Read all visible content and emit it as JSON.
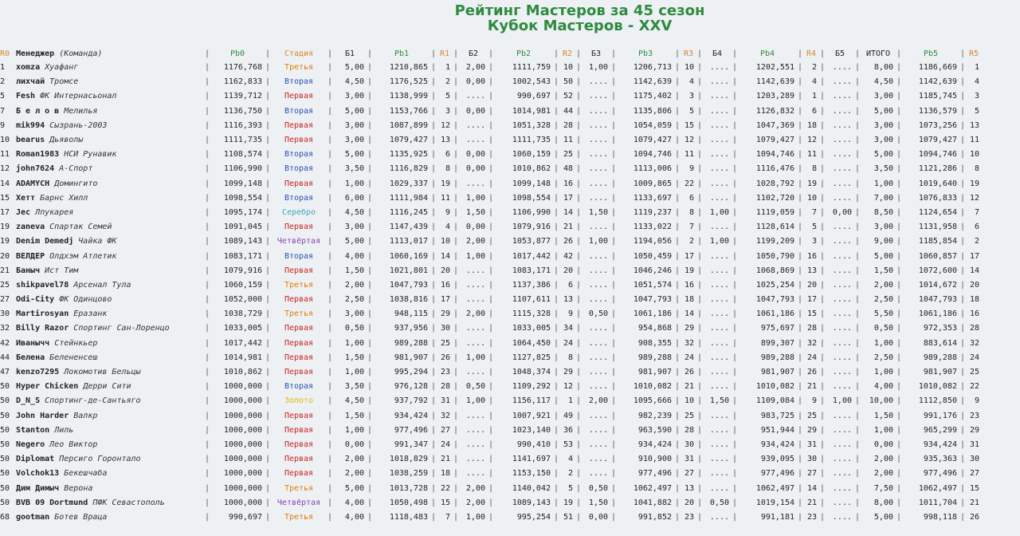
{
  "title": {
    "line1": "Рейтинг Мастеров за 45 сезон",
    "line2": "Кубок Мастеров - XXV"
  },
  "colors": {
    "title": "#2e8b3e",
    "background": "#edf1f4",
    "Третья": "#e07b00",
    "Вторая": "#2a4fb5",
    "Первая": "#d02020",
    "Серебро": "#3aa9b5",
    "Четвёртая": "#8a3fb5",
    "Золото": "#f0b400"
  },
  "header": {
    "r0": "R0",
    "manager": "Менеджер",
    "team": "(Команда)",
    "rb0": "Рb0",
    "stage": "Стадия",
    "b1": "Б1",
    "rb1": "Рb1",
    "r1": "R1",
    "b2": "Б2",
    "rb2": "Рb2",
    "r2": "R2",
    "b3": "Б3",
    "rb3": "Рb3",
    "r3": "R3",
    "b4": "Б4",
    "rb4": "Рb4",
    "r4": "R4",
    "b5": "Б5",
    "total": "ИТОГО",
    "rb5": "Рb5",
    "r5": "R5"
  },
  "rows": [
    {
      "r0": "1",
      "manager": "xomza",
      "team": "Хуафанг",
      "rb0": "1176,768",
      "stage": "Третья",
      "b1": "5,00",
      "rb1": "1210,865",
      "r1": "1",
      "b2": "2,00",
      "rb2": "1111,759",
      "r2": "10",
      "b3": "1,00",
      "rb3": "1206,713",
      "r3": "10",
      "b4": "....",
      "rb4": "1202,551",
      "r4": "2",
      "b5": "....",
      "total": "8,00",
      "rb5": "1186,669",
      "r5": "1"
    },
    {
      "r0": "2",
      "manager": "лихчай",
      "team": "Тромсе",
      "rb0": "1162,833",
      "stage": "Вторая",
      "b1": "4,50",
      "rb1": "1176,525",
      "r1": "2",
      "b2": "0,00",
      "rb2": "1002,543",
      "r2": "50",
      "b3": "....",
      "rb3": "1142,639",
      "r3": "4",
      "b4": "....",
      "rb4": "1142,639",
      "r4": "4",
      "b5": "....",
      "total": "4,50",
      "rb5": "1142,639",
      "r5": "4"
    },
    {
      "r0": "5",
      "manager": "Fesh",
      "team": "ФК Интернасьонал",
      "rb0": "1139,712",
      "stage": "Первая",
      "b1": "3,00",
      "rb1": "1138,999",
      "r1": "5",
      "b2": "....",
      "rb2": "990,697",
      "r2": "52",
      "b3": "....",
      "rb3": "1175,402",
      "r3": "3",
      "b4": "....",
      "rb4": "1203,289",
      "r4": "1",
      "b5": "....",
      "total": "3,00",
      "rb5": "1185,745",
      "r5": "3"
    },
    {
      "r0": "7",
      "manager": "Б е л о в",
      "team": "Мелилья",
      "rb0": "1136,750",
      "stage": "Вторая",
      "b1": "5,00",
      "rb1": "1153,766",
      "r1": "3",
      "b2": "0,00",
      "rb2": "1014,981",
      "r2": "44",
      "b3": "....",
      "rb3": "1135,806",
      "r3": "5",
      "b4": "....",
      "rb4": "1126,832",
      "r4": "6",
      "b5": "....",
      "total": "5,00",
      "rb5": "1136,579",
      "r5": "5"
    },
    {
      "r0": "9",
      "manager": "mik994",
      "team": "Сызрань-2003",
      "rb0": "1116,393",
      "stage": "Первая",
      "b1": "3,00",
      "rb1": "1087,899",
      "r1": "12",
      "b2": "....",
      "rb2": "1051,328",
      "r2": "28",
      "b3": "....",
      "rb3": "1054,059",
      "r3": "15",
      "b4": "....",
      "rb4": "1047,369",
      "r4": "18",
      "b5": "....",
      "total": "3,00",
      "rb5": "1073,256",
      "r5": "13"
    },
    {
      "r0": "10",
      "manager": "bearus",
      "team": "Дьяволы",
      "rb0": "1111,735",
      "stage": "Первая",
      "b1": "3,00",
      "rb1": "1079,427",
      "r1": "13",
      "b2": "....",
      "rb2": "1111,735",
      "r2": "11",
      "b3": "....",
      "rb3": "1079,427",
      "r3": "12",
      "b4": "....",
      "rb4": "1079,427",
      "r4": "12",
      "b5": "....",
      "total": "3,00",
      "rb5": "1079,427",
      "r5": "11"
    },
    {
      "r0": "11",
      "manager": "Roman1983",
      "team": "НСИ Рунавик",
      "rb0": "1108,574",
      "stage": "Вторая",
      "b1": "5,00",
      "rb1": "1135,925",
      "r1": "6",
      "b2": "0,00",
      "rb2": "1060,159",
      "r2": "25",
      "b3": "....",
      "rb3": "1094,746",
      "r3": "11",
      "b4": "....",
      "rb4": "1094,746",
      "r4": "11",
      "b5": "....",
      "total": "5,00",
      "rb5": "1094,746",
      "r5": "10"
    },
    {
      "r0": "12",
      "manager": "john7624",
      "team": "А-Спорт",
      "rb0": "1106,990",
      "stage": "Вторая",
      "b1": "3,50",
      "rb1": "1116,829",
      "r1": "8",
      "b2": "0,00",
      "rb2": "1010,862",
      "r2": "48",
      "b3": "....",
      "rb3": "1113,006",
      "r3": "9",
      "b4": "....",
      "rb4": "1116,476",
      "r4": "8",
      "b5": "....",
      "total": "3,50",
      "rb5": "1121,286",
      "r5": "8"
    },
    {
      "r0": "14",
      "manager": "ADAMYCH",
      "team": "Домингито",
      "rb0": "1099,148",
      "stage": "Первая",
      "b1": "1,00",
      "rb1": "1029,337",
      "r1": "19",
      "b2": "....",
      "rb2": "1099,148",
      "r2": "16",
      "b3": "....",
      "rb3": "1009,865",
      "r3": "22",
      "b4": "....",
      "rb4": "1028,792",
      "r4": "19",
      "b5": "....",
      "total": "1,00",
      "rb5": "1019,640",
      "r5": "19"
    },
    {
      "r0": "15",
      "manager": "Хетт",
      "team": "Барнс Хилл",
      "rb0": "1098,554",
      "stage": "Вторая",
      "b1": "6,00",
      "rb1": "1111,984",
      "r1": "11",
      "b2": "1,00",
      "rb2": "1098,554",
      "r2": "17",
      "b3": "....",
      "rb3": "1133,697",
      "r3": "6",
      "b4": "....",
      "rb4": "1102,720",
      "r4": "10",
      "b5": "....",
      "total": "7,00",
      "rb5": "1076,833",
      "r5": "12"
    },
    {
      "r0": "17",
      "manager": "Jec",
      "team": "Лпукарея",
      "rb0": "1095,174",
      "stage": "Серебро",
      "b1": "4,50",
      "rb1": "1116,245",
      "r1": "9",
      "b2": "1,50",
      "rb2": "1106,990",
      "r2": "14",
      "b3": "1,50",
      "rb3": "1119,237",
      "r3": "8",
      "b4": "1,00",
      "rb4": "1119,059",
      "r4": "7",
      "b5": "0,00",
      "total": "8,50",
      "rb5": "1124,654",
      "r5": "7"
    },
    {
      "r0": "19",
      "manager": "zaneva",
      "team": "Спартак Семей",
      "rb0": "1091,045",
      "stage": "Первая",
      "b1": "3,00",
      "rb1": "1147,439",
      "r1": "4",
      "b2": "0,00",
      "rb2": "1079,916",
      "r2": "21",
      "b3": "....",
      "rb3": "1133,022",
      "r3": "7",
      "b4": "....",
      "rb4": "1128,614",
      "r4": "5",
      "b5": "....",
      "total": "3,00",
      "rb5": "1131,958",
      "r5": "6"
    },
    {
      "r0": "19",
      "manager": "Denim Demedj",
      "team": "Чайка ФК",
      "rb0": "1089,143",
      "stage": "Четвёртая",
      "b1": "5,00",
      "rb1": "1113,017",
      "r1": "10",
      "b2": "2,00",
      "rb2": "1053,877",
      "r2": "26",
      "b3": "1,00",
      "rb3": "1194,056",
      "r3": "2",
      "b4": "1,00",
      "rb4": "1199,209",
      "r4": "3",
      "b5": "....",
      "total": "9,00",
      "rb5": "1185,854",
      "r5": "2"
    },
    {
      "r0": "20",
      "manager": "ВЕЛДЕР",
      "team": "Олдхэм Атлетик",
      "rb0": "1083,171",
      "stage": "Вторая",
      "b1": "4,00",
      "rb1": "1060,169",
      "r1": "14",
      "b2": "1,00",
      "rb2": "1017,442",
      "r2": "42",
      "b3": "....",
      "rb3": "1050,459",
      "r3": "17",
      "b4": "....",
      "rb4": "1050,790",
      "r4": "16",
      "b5": "....",
      "total": "5,00",
      "rb5": "1060,857",
      "r5": "17"
    },
    {
      "r0": "21",
      "manager": "Баныч",
      "team": "Ист Тим",
      "rb0": "1079,916",
      "stage": "Первая",
      "b1": "1,50",
      "rb1": "1021,801",
      "r1": "20",
      "b2": "....",
      "rb2": "1083,171",
      "r2": "20",
      "b3": "....",
      "rb3": "1046,246",
      "r3": "19",
      "b4": "....",
      "rb4": "1068,869",
      "r4": "13",
      "b5": "....",
      "total": "1,50",
      "rb5": "1072,600",
      "r5": "14"
    },
    {
      "r0": "25",
      "manager": "shikpavel78",
      "team": "Арсенал Тула",
      "rb0": "1060,159",
      "stage": "Третья",
      "b1": "2,00",
      "rb1": "1047,793",
      "r1": "16",
      "b2": "....",
      "rb2": "1137,386",
      "r2": "6",
      "b3": "....",
      "rb3": "1051,574",
      "r3": "16",
      "b4": "....",
      "rb4": "1025,254",
      "r4": "20",
      "b5": "....",
      "total": "2,00",
      "rb5": "1014,672",
      "r5": "20"
    },
    {
      "r0": "27",
      "manager": "Odi-City",
      "team": "ФК Одинцово",
      "rb0": "1052,000",
      "stage": "Первая",
      "b1": "2,50",
      "rb1": "1038,816",
      "r1": "17",
      "b2": "....",
      "rb2": "1107,611",
      "r2": "13",
      "b3": "....",
      "rb3": "1047,793",
      "r3": "18",
      "b4": "....",
      "rb4": "1047,793",
      "r4": "17",
      "b5": "....",
      "total": "2,50",
      "rb5": "1047,793",
      "r5": "18"
    },
    {
      "r0": "30",
      "manager": "Martirosyan",
      "team": "Еразанк",
      "rb0": "1038,729",
      "stage": "Третья",
      "b1": "3,00",
      "rb1": "948,115",
      "r1": "29",
      "b2": "2,00",
      "rb2": "1115,328",
      "r2": "9",
      "b3": "0,50",
      "rb3": "1061,186",
      "r3": "14",
      "b4": "....",
      "rb4": "1061,186",
      "r4": "15",
      "b5": "....",
      "total": "5,50",
      "rb5": "1061,186",
      "r5": "16"
    },
    {
      "r0": "32",
      "manager": "Billy Razor",
      "team": "Спортинг Сан-Лоренцо",
      "rb0": "1033,005",
      "stage": "Первая",
      "b1": "0,50",
      "rb1": "937,956",
      "r1": "30",
      "b2": "....",
      "rb2": "1033,005",
      "r2": "34",
      "b3": "....",
      "rb3": "954,868",
      "r3": "29",
      "b4": "....",
      "rb4": "975,697",
      "r4": "28",
      "b5": "....",
      "total": "0,50",
      "rb5": "972,353",
      "r5": "28"
    },
    {
      "r0": "42",
      "manager": "Иванычч",
      "team": "Стейнкьер",
      "rb0": "1017,442",
      "stage": "Первая",
      "b1": "1,00",
      "rb1": "989,288",
      "r1": "25",
      "b2": "....",
      "rb2": "1064,450",
      "r2": "24",
      "b3": "....",
      "rb3": "908,355",
      "r3": "32",
      "b4": "....",
      "rb4": "899,307",
      "r4": "32",
      "b5": "....",
      "total": "1,00",
      "rb5": "883,614",
      "r5": "32"
    },
    {
      "r0": "44",
      "manager": "Белена",
      "team": "Белененсеш",
      "rb0": "1014,981",
      "stage": "Первая",
      "b1": "1,50",
      "rb1": "981,907",
      "r1": "26",
      "b2": "1,00",
      "rb2": "1127,825",
      "r2": "8",
      "b3": "....",
      "rb3": "989,288",
      "r3": "24",
      "b4": "....",
      "rb4": "989,288",
      "r4": "24",
      "b5": "....",
      "total": "2,50",
      "rb5": "989,288",
      "r5": "24"
    },
    {
      "r0": "47",
      "manager": "kenzo7295",
      "team": "Локомотив Бельцы",
      "rb0": "1010,862",
      "stage": "Первая",
      "b1": "1,00",
      "rb1": "995,294",
      "r1": "23",
      "b2": "....",
      "rb2": "1048,374",
      "r2": "29",
      "b3": "....",
      "rb3": "981,907",
      "r3": "26",
      "b4": "....",
      "rb4": "981,907",
      "r4": "26",
      "b5": "....",
      "total": "1,00",
      "rb5": "981,907",
      "r5": "25"
    },
    {
      "r0": "50",
      "manager": "Hyper Chicken",
      "team": "Дерри Сити",
      "rb0": "1000,000",
      "stage": "Вторая",
      "b1": "3,50",
      "rb1": "976,128",
      "r1": "28",
      "b2": "0,50",
      "rb2": "1109,292",
      "r2": "12",
      "b3": "....",
      "rb3": "1010,082",
      "r3": "21",
      "b4": "....",
      "rb4": "1010,082",
      "r4": "21",
      "b5": "....",
      "total": "4,00",
      "rb5": "1010,082",
      "r5": "22"
    },
    {
      "r0": "50",
      "manager": "D_N_S",
      "team": "Спортинг-де-Сантьяго",
      "rb0": "1000,000",
      "stage": "Золото",
      "b1": "4,50",
      "rb1": "937,792",
      "r1": "31",
      "b2": "1,00",
      "rb2": "1156,117",
      "r2": "1",
      "b3": "2,00",
      "rb3": "1095,666",
      "r3": "10",
      "b4": "1,50",
      "rb4": "1109,084",
      "r4": "9",
      "b5": "1,00",
      "total": "10,00",
      "rb5": "1112,850",
      "r5": "9"
    },
    {
      "r0": "50",
      "manager": "John Harder",
      "team": "Валкр",
      "rb0": "1000,000",
      "stage": "Первая",
      "b1": "1,50",
      "rb1": "934,424",
      "r1": "32",
      "b2": "....",
      "rb2": "1007,921",
      "r2": "49",
      "b3": "....",
      "rb3": "982,239",
      "r3": "25",
      "b4": "....",
      "rb4": "983,725",
      "r4": "25",
      "b5": "....",
      "total": "1,50",
      "rb5": "991,176",
      "r5": "23"
    },
    {
      "r0": "50",
      "manager": "Stanton",
      "team": "Лиль",
      "rb0": "1000,000",
      "stage": "Первая",
      "b1": "1,00",
      "rb1": "977,496",
      "r1": "27",
      "b2": "....",
      "rb2": "1023,140",
      "r2": "36",
      "b3": "....",
      "rb3": "963,590",
      "r3": "28",
      "b4": "....",
      "rb4": "951,944",
      "r4": "29",
      "b5": "....",
      "total": "1,00",
      "rb5": "965,299",
      "r5": "29"
    },
    {
      "r0": "50",
      "manager": "Negero",
      "team": "Лео Виктор",
      "rb0": "1000,000",
      "stage": "Первая",
      "b1": "0,00",
      "rb1": "991,347",
      "r1": "24",
      "b2": "....",
      "rb2": "990,410",
      "r2": "53",
      "b3": "....",
      "rb3": "934,424",
      "r3": "30",
      "b4": "....",
      "rb4": "934,424",
      "r4": "31",
      "b5": "....",
      "total": "0,00",
      "rb5": "934,424",
      "r5": "31"
    },
    {
      "r0": "50",
      "manager": "Diplomat",
      "team": "Персиго Горонтало",
      "rb0": "1000,000",
      "stage": "Первая",
      "b1": "2,00",
      "rb1": "1018,829",
      "r1": "21",
      "b2": "....",
      "rb2": "1141,697",
      "r2": "4",
      "b3": "....",
      "rb3": "910,900",
      "r3": "31",
      "b4": "....",
      "rb4": "939,095",
      "r4": "30",
      "b5": "....",
      "total": "2,00",
      "rb5": "935,363",
      "r5": "30"
    },
    {
      "r0": "50",
      "manager": "Volchok13",
      "team": "Бекешчаба",
      "rb0": "1000,000",
      "stage": "Первая",
      "b1": "2,00",
      "rb1": "1038,259",
      "r1": "18",
      "b2": "....",
      "rb2": "1153,150",
      "r2": "2",
      "b3": "....",
      "rb3": "977,496",
      "r3": "27",
      "b4": "....",
      "rb4": "977,496",
      "r4": "27",
      "b5": "....",
      "total": "2,00",
      "rb5": "977,496",
      "r5": "27"
    },
    {
      "r0": "50",
      "manager": "Дим Димыч",
      "team": "Верона",
      "rb0": "1000,000",
      "stage": "Третья",
      "b1": "5,00",
      "rb1": "1013,728",
      "r1": "22",
      "b2": "2,00",
      "rb2": "1140,042",
      "r2": "5",
      "b3": "0,50",
      "rb3": "1062,497",
      "r3": "13",
      "b4": "....",
      "rb4": "1062,497",
      "r4": "14",
      "b5": "....",
      "total": "7,50",
      "rb5": "1062,497",
      "r5": "15"
    },
    {
      "r0": "50",
      "manager": "BVB 09 Dortmund",
      "team": "ПФК Севастополь",
      "rb0": "1000,000",
      "stage": "Четвёртая",
      "b1": "4,00",
      "rb1": "1050,498",
      "r1": "15",
      "b2": "2,00",
      "rb2": "1089,143",
      "r2": "19",
      "b3": "1,50",
      "rb3": "1041,882",
      "r3": "20",
      "b4": "0,50",
      "rb4": "1019,154",
      "r4": "21",
      "b5": "....",
      "total": "8,00",
      "rb5": "1011,704",
      "r5": "21"
    },
    {
      "r0": "68",
      "manager": "gootman",
      "team": "Ботев Враца",
      "rb0": "990,697",
      "stage": "Третья",
      "b1": "4,00",
      "rb1": "1118,483",
      "r1": "7",
      "b2": "1,00",
      "rb2": "995,254",
      "r2": "51",
      "b3": "0,00",
      "rb3": "991,852",
      "r3": "23",
      "b4": "....",
      "rb4": "991,181",
      "r4": "23",
      "b5": "....",
      "total": "5,00",
      "rb5": "998,118",
      "r5": "26"
    }
  ]
}
